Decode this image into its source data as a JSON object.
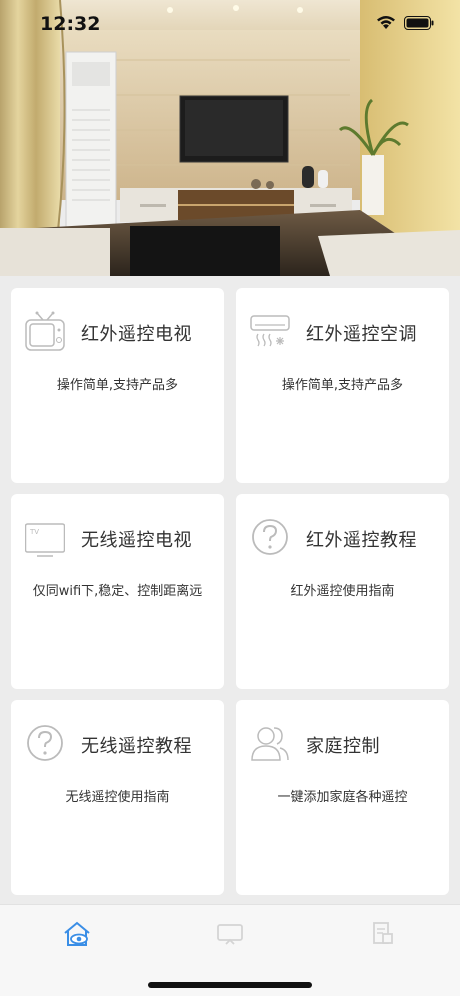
{
  "status_bar": {
    "time": "12:32"
  },
  "cards": [
    {
      "id": "ir-tv",
      "title": "红外遥控电视",
      "subtitle": "操作简单,支持产品多",
      "icon": "tv-antenna-icon"
    },
    {
      "id": "ir-ac",
      "title": "红外遥控空调",
      "subtitle": "操作简单,支持产品多",
      "icon": "air-conditioner-icon"
    },
    {
      "id": "wifi-tv",
      "title": "无线遥控电视",
      "subtitle": "仅同wifi下,稳定、控制距离远",
      "icon": "tv-monitor-icon"
    },
    {
      "id": "ir-guide",
      "title": "红外遥控教程",
      "subtitle": "红外遥控使用指南",
      "icon": "help-circle-icon"
    },
    {
      "id": "wifi-guide",
      "title": "无线遥控教程",
      "subtitle": "无线遥控使用指南",
      "icon": "help-circle-icon"
    },
    {
      "id": "family",
      "title": "家庭控制",
      "subtitle": "一键添加家庭各种遥控",
      "icon": "family-users-icon"
    }
  ],
  "tabbar": {
    "tabs": [
      {
        "icon": "home-icon",
        "active": true
      },
      {
        "icon": "screen-icon",
        "active": false
      },
      {
        "icon": "document-icon",
        "active": false
      }
    ],
    "active_color": "#3a8ee6"
  }
}
